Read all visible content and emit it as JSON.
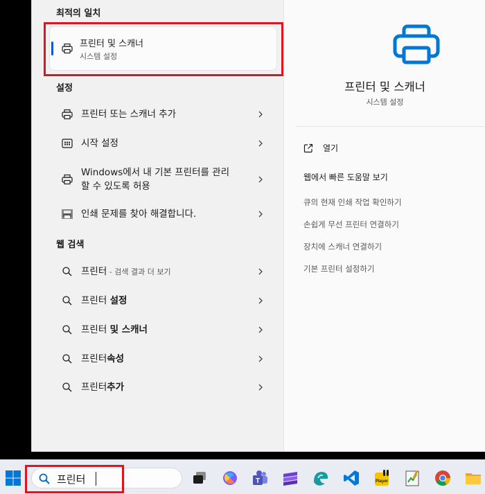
{
  "left": {
    "best_match_title": "최적의 일치",
    "best_match": {
      "title": "프린터 및 스캐너",
      "subtitle": "시스템 설정"
    },
    "settings_title": "설정",
    "settings_items": [
      {
        "label": "프린터 또는 스캐너 추가",
        "icon": "printer-icon"
      },
      {
        "label": "시작 설정",
        "icon": "start-settings-icon"
      },
      {
        "label_line1": "Windows에서 내 기본 프린터를 관리",
        "label_line2": "할 수 있도록 허용",
        "icon": "printer-icon"
      },
      {
        "label": "인쇄 문제를 찾아 해결합니다.",
        "icon": "troubleshoot-printer-icon"
      }
    ],
    "web_title": "웹 검색",
    "web_items": [
      {
        "prefix": "프린터",
        "suffix": " - 검색 결과 더 보기"
      },
      {
        "prefix": "프린터 ",
        "bold": "설정"
      },
      {
        "prefix": "프린터 ",
        "bold": "및 스캐너"
      },
      {
        "prefix": "프린터",
        "bold": "속성"
      },
      {
        "prefix": "프린터",
        "bold": "추가"
      }
    ]
  },
  "right": {
    "title": "프린터 및 스캐너",
    "subtitle": "시스템 설정",
    "open_label": "열기",
    "web_help_title": "웹에서 빠른 도움말 보기",
    "links": [
      "큐의 현재 인쇄 작업 확인하기",
      "손쉽게 무선 프린터 연결하기",
      "장치에 스캐너 연결하기",
      "기본 프린터 설정하기"
    ]
  },
  "taskbar": {
    "search_value": "프린터",
    "icons": [
      "task-view-icon",
      "copilot-icon",
      "teams-icon",
      "stack-app-icon",
      "edge-dev-icon",
      "vscode-icon",
      "potplayer-icon",
      "notepad-chart-icon",
      "chrome-icon",
      "file-explorer-icon"
    ]
  },
  "colors": {
    "accent": "#005fb8",
    "highlight": "#e0141e",
    "panel": "#f3f3f3"
  }
}
